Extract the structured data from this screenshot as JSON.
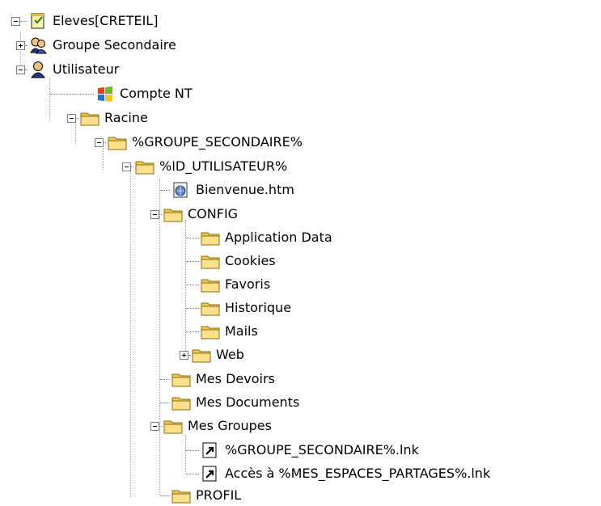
{
  "tree": {
    "root": {
      "label": "Eleves",
      "suffix": "[CRETEIL]",
      "icon": "note-icon"
    },
    "items": [
      {
        "label": "Groupe Secondaire",
        "icon": "group-icon"
      },
      {
        "label": "Utilisateur",
        "icon": "user-icon"
      },
      {
        "label": "Compte NT",
        "icon": "windows-icon"
      },
      {
        "label": "Racine",
        "icon": "folder-icon"
      },
      {
        "label": "%GROUPE_SECONDAIRE%",
        "icon": "folder-icon"
      },
      {
        "label": "%ID_UTILISATEUR%",
        "icon": "folder-icon"
      },
      {
        "label": "Bienvenue.htm",
        "icon": "html-file-icon"
      },
      {
        "label": "CONFIG",
        "icon": "folder-icon"
      },
      {
        "label": "Application Data",
        "icon": "folder-icon"
      },
      {
        "label": "Cookies",
        "icon": "folder-icon"
      },
      {
        "label": "Favoris",
        "icon": "folder-icon"
      },
      {
        "label": "Historique",
        "icon": "folder-icon"
      },
      {
        "label": "Mails",
        "icon": "folder-icon"
      },
      {
        "label": "Web",
        "icon": "folder-icon"
      },
      {
        "label": "Mes Devoirs",
        "icon": "folder-icon"
      },
      {
        "label": "Mes Documents",
        "icon": "folder-icon"
      },
      {
        "label": "Mes Groupes",
        "icon": "folder-icon"
      },
      {
        "label": "%GROUPE_SECONDAIRE%.lnk",
        "icon": "shortcut-icon"
      },
      {
        "label": "Accès à %MES_ESPACES_PARTAGES%.lnk",
        "icon": "shortcut-icon"
      },
      {
        "label": "PROFIL",
        "icon": "folder-icon"
      }
    ]
  }
}
